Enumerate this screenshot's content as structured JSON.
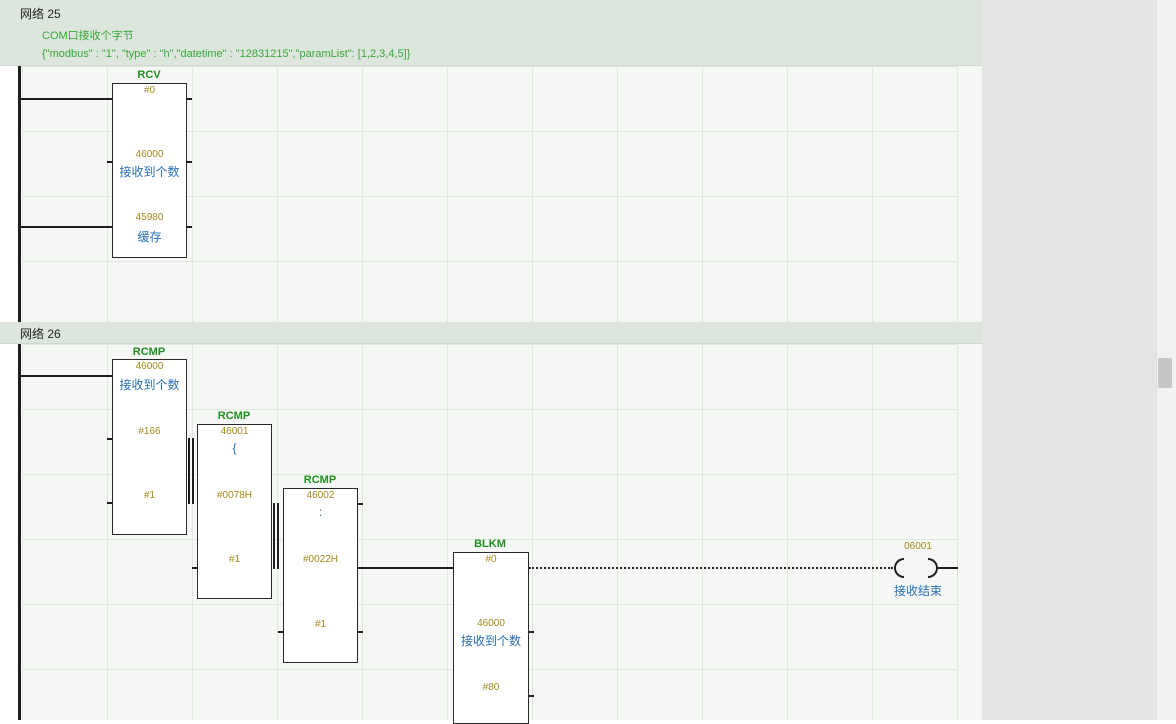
{
  "networks": [
    {
      "title": "网络 25",
      "comment_line1": "COM口接收个字节",
      "comment_line2": "{\"modbus\" : \"1\", \"type\" : \"h\",\"datetime\" : \"12831215\",\"paramList\": [1,2,3,4,5]}"
    },
    {
      "title": "网络 26"
    }
  ],
  "blocks": {
    "rcv": {
      "name": "RCV",
      "top_operand": "#0",
      "in1_operand": "46000",
      "in1_symbol": "接收到个数",
      "in2_operand": "45980",
      "in2_symbol": "缓存"
    },
    "rcmp1": {
      "name": "RCMP",
      "top_operand": "46000",
      "top_symbol": "接收到个数",
      "in1_operand": "#166",
      "in2_operand": "#1"
    },
    "rcmp2": {
      "name": "RCMP",
      "top_operand": "46001",
      "top_symbol": "{",
      "in1_operand": "#0078H",
      "in2_operand": "#1"
    },
    "rcmp3": {
      "name": "RCMP",
      "top_operand": "46002",
      "top_symbol": ":",
      "in1_operand": "#0022H",
      "in2_operand": "#1"
    },
    "blkm": {
      "name": "BLKM",
      "top_operand": "#0",
      "in1_operand": "46000",
      "in1_symbol": "接收到个数",
      "in2_operand": "#80"
    }
  },
  "coil": {
    "operand": "06001",
    "symbol": "接收结束"
  }
}
